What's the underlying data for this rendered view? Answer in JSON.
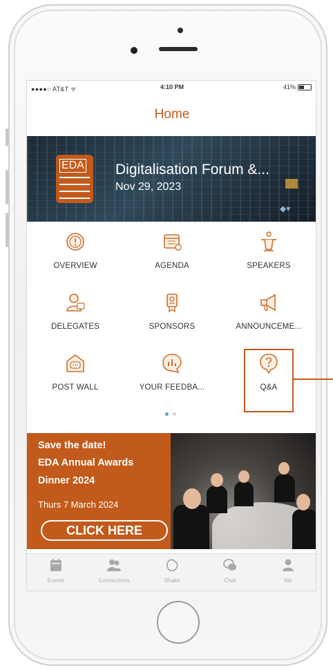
{
  "status_bar": {
    "carrier": "●●●●○ AT&T ᯤ",
    "time": "4:10 PM",
    "battery": "41%"
  },
  "nav": {
    "title": "Home"
  },
  "banner": {
    "logo_text": "EDA",
    "title": "Digitalisation Forum &...",
    "date": "Nov 29, 2023"
  },
  "menu": {
    "items": [
      {
        "label": "OVERVIEW",
        "icon": "info-icon"
      },
      {
        "label": "AGENDA",
        "icon": "calendar-icon"
      },
      {
        "label": "SPEAKERS",
        "icon": "podium-icon"
      },
      {
        "label": "DELEGATES",
        "icon": "people-icon"
      },
      {
        "label": "SPONSORS",
        "icon": "badge-icon"
      },
      {
        "label": "ANNOUNCEME...",
        "icon": "megaphone-icon"
      },
      {
        "label": "POST WALL",
        "icon": "post-wall-icon"
      },
      {
        "label": "YOUR FEEDBA...",
        "icon": "feedback-chart-icon"
      },
      {
        "label": "Q&A",
        "icon": "question-icon"
      }
    ],
    "page_indicator": {
      "pages": 2,
      "current": 1
    }
  },
  "ad": {
    "line1": "Save the date!",
    "line2": "EDA Annual Awards",
    "line3": "Dinner 2024",
    "subline": "Thurs 7 March 2024",
    "cta": "CLICK HERE"
  },
  "tabbar": {
    "items": [
      {
        "label": "Events",
        "icon": "calendar-icon"
      },
      {
        "label": "Connections",
        "icon": "connections-icon"
      },
      {
        "label": "Shake",
        "icon": "shake-icon"
      },
      {
        "label": "Chat",
        "icon": "chat-icon"
      },
      {
        "label": "Me",
        "icon": "profile-icon"
      }
    ]
  },
  "colors": {
    "accent": "#c25a1c",
    "icon_stroke": "#c8702f",
    "tab_inactive": "#a9a9a9",
    "dot_active": "#5a9fd4",
    "dot_inactive": "#cfd8e0"
  }
}
